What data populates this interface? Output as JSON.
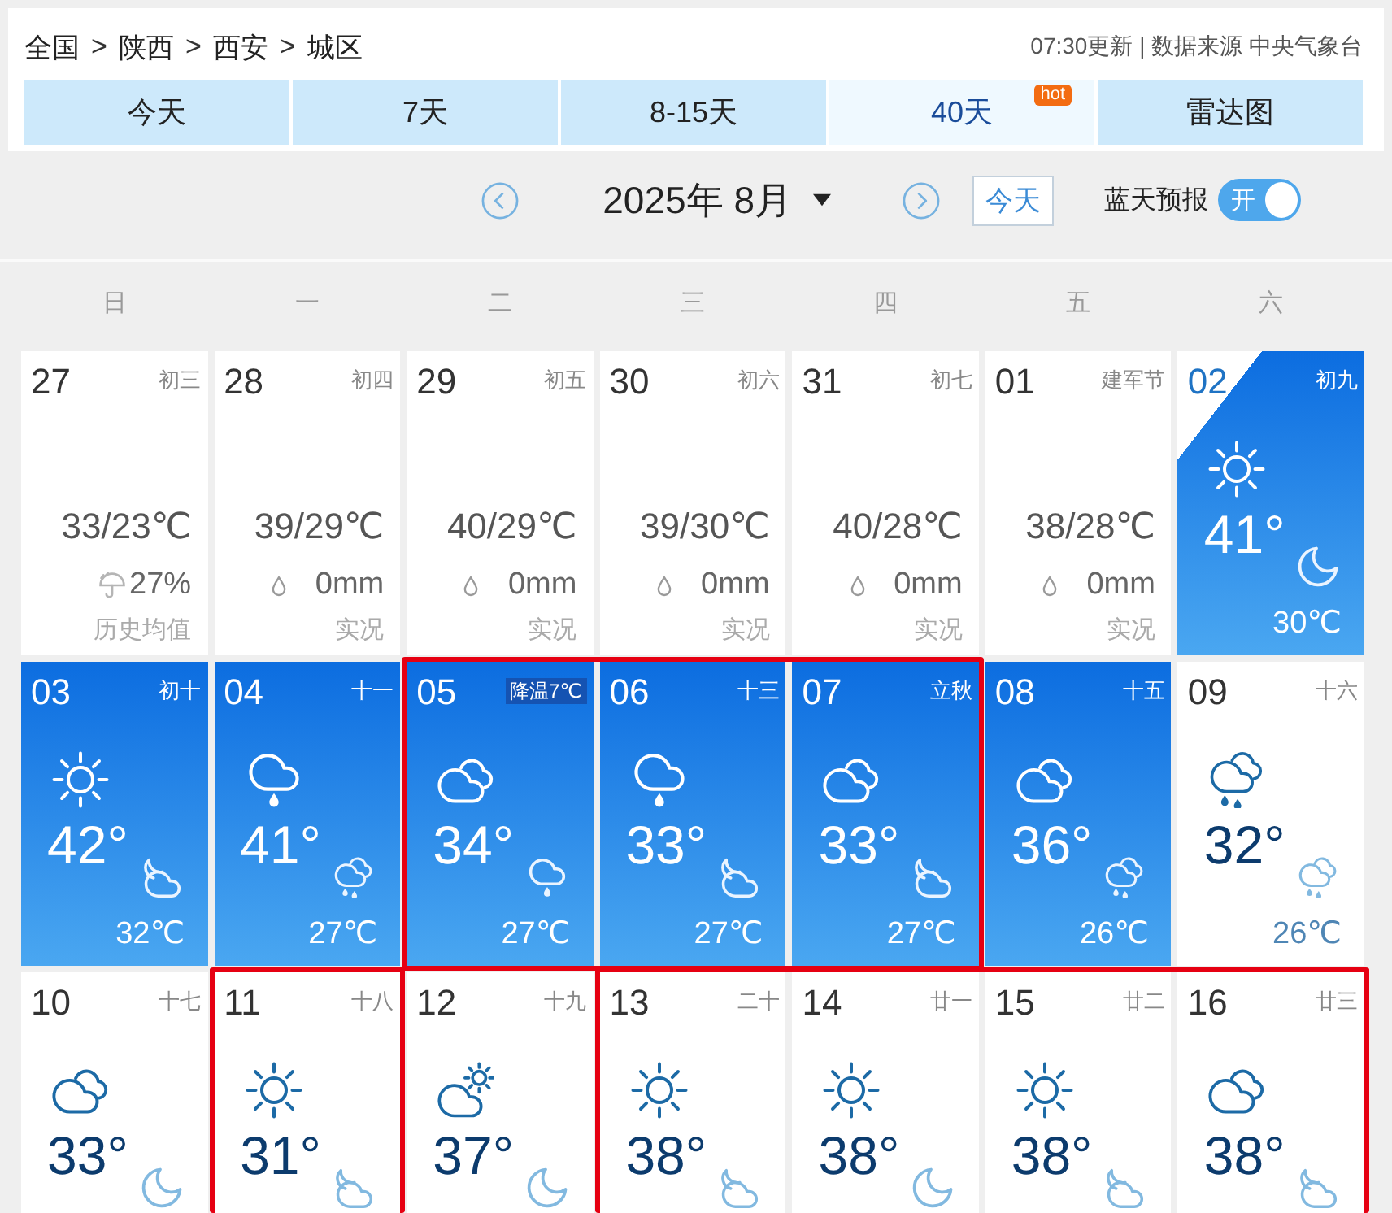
{
  "breadcrumb": {
    "items": [
      "全国",
      "陕西",
      "西安",
      "城区"
    ],
    "separator": ">"
  },
  "update_info": "07:30更新 | 数据来源 中央气象台",
  "tabs": [
    {
      "label": "今天",
      "selected": false
    },
    {
      "label": "7天",
      "selected": false
    },
    {
      "label": "8-15天",
      "selected": false
    },
    {
      "label": "40天",
      "selected": true,
      "badge": "hot"
    },
    {
      "label": "雷达图",
      "selected": false
    }
  ],
  "month_nav": {
    "month": "2025年 8月",
    "today_button": "今天"
  },
  "blue_sky": {
    "label": "蓝天预报",
    "on": true,
    "switch_text": "开"
  },
  "weekdays": [
    "日",
    "一",
    "二",
    "三",
    "四",
    "五",
    "六"
  ],
  "days": [
    {
      "date": "27",
      "lunar": "初三",
      "kind": "past",
      "temp": "33/23℃",
      "precip": {
        "kind": "chance",
        "value": "27%"
      },
      "note": "历史均值",
      "marked": false
    },
    {
      "date": "28",
      "lunar": "初四",
      "kind": "past",
      "temp": "39/29℃",
      "precip": {
        "kind": "amount",
        "value": "0mm"
      },
      "note": "实况",
      "marked": false
    },
    {
      "date": "29",
      "lunar": "初五",
      "kind": "past",
      "temp": "40/29℃",
      "precip": {
        "kind": "amount",
        "value": "0mm"
      },
      "note": "实况",
      "marked": false
    },
    {
      "date": "30",
      "lunar": "初六",
      "kind": "past",
      "temp": "39/30℃",
      "precip": {
        "kind": "amount",
        "value": "0mm"
      },
      "note": "实况",
      "marked": false
    },
    {
      "date": "31",
      "lunar": "初七",
      "kind": "past",
      "temp": "40/28℃",
      "precip": {
        "kind": "amount",
        "value": "0mm"
      },
      "note": "实况",
      "marked": false
    },
    {
      "date": "01",
      "lunar": "建军节",
      "kind": "past",
      "temp": "38/28℃",
      "precip": {
        "kind": "amount",
        "value": "0mm"
      },
      "note": "实况",
      "marked": false
    },
    {
      "date": "02",
      "lunar": "初九",
      "kind": "today",
      "high": "41°",
      "low": "30℃",
      "day_weather": {
        "kind": "sunny"
      },
      "night_weather": {
        "kind": "clear"
      },
      "marked": false
    },
    {
      "date": "03",
      "lunar": "初十",
      "kind": "near",
      "high": "42°",
      "low": "32℃",
      "day_weather": {
        "kind": "sunny"
      },
      "night_weather": {
        "kind": "cloudy-night"
      },
      "marked": false
    },
    {
      "date": "04",
      "lunar": "十一",
      "kind": "near",
      "high": "41°",
      "low": "27℃",
      "day_weather": {
        "kind": "rain"
      },
      "night_weather": {
        "kind": "shower"
      },
      "marked": false
    },
    {
      "date": "05",
      "badge": "降温7℃",
      "kind": "near",
      "high": "34°",
      "low": "27℃",
      "day_weather": {
        "kind": "cloudy"
      },
      "night_weather": {
        "kind": "rain"
      },
      "marked": true
    },
    {
      "date": "06",
      "lunar": "十三",
      "kind": "near",
      "high": "33°",
      "low": "27℃",
      "day_weather": {
        "kind": "rain"
      },
      "night_weather": {
        "kind": "cloudy-night"
      },
      "marked": true
    },
    {
      "date": "07",
      "lunar": "立秋",
      "kind": "near",
      "high": "33°",
      "low": "27℃",
      "day_weather": {
        "kind": "cloudy"
      },
      "night_weather": {
        "kind": "cloudy-night"
      },
      "marked": true
    },
    {
      "date": "08",
      "lunar": "十五",
      "kind": "near",
      "high": "36°",
      "low": "26℃",
      "day_weather": {
        "kind": "cloudy"
      },
      "night_weather": {
        "kind": "shower"
      },
      "marked": false
    },
    {
      "date": "09",
      "lunar": "十六",
      "kind": "extended",
      "high": "32°",
      "low": "26℃",
      "day_weather": {
        "kind": "shower"
      },
      "night_weather": {
        "kind": "shower"
      },
      "marked": false
    },
    {
      "date": "10",
      "lunar": "十七",
      "kind": "extended",
      "high": "33°",
      "day_weather": {
        "kind": "cloudy"
      },
      "night_weather": {
        "kind": "clear"
      },
      "marked": false
    },
    {
      "date": "11",
      "lunar": "十八",
      "kind": "extended",
      "high": "31°",
      "day_weather": {
        "kind": "sunny"
      },
      "night_weather": {
        "kind": "cloudy-night"
      },
      "marked": true
    },
    {
      "date": "12",
      "lunar": "十九",
      "kind": "extended",
      "high": "37°",
      "day_weather": {
        "kind": "partly-cloudy"
      },
      "night_weather": {
        "kind": "clear"
      },
      "marked": false
    },
    {
      "date": "13",
      "lunar": "二十",
      "kind": "extended",
      "high": "38°",
      "day_weather": {
        "kind": "sunny"
      },
      "night_weather": {
        "kind": "cloudy-night"
      },
      "marked": true
    },
    {
      "date": "14",
      "lunar": "廿一",
      "kind": "extended",
      "high": "38°",
      "day_weather": {
        "kind": "sunny"
      },
      "night_weather": {
        "kind": "clear"
      },
      "marked": true
    },
    {
      "date": "15",
      "lunar": "廿二",
      "kind": "extended",
      "high": "38°",
      "day_weather": {
        "kind": "sunny"
      },
      "night_weather": {
        "kind": "cloudy-night"
      },
      "marked": true
    },
    {
      "date": "16",
      "lunar": "廿三",
      "kind": "extended",
      "high": "38°",
      "day_weather": {
        "kind": "cloudy"
      },
      "night_weather": {
        "kind": "cloudy-night"
      },
      "marked": true
    }
  ]
}
